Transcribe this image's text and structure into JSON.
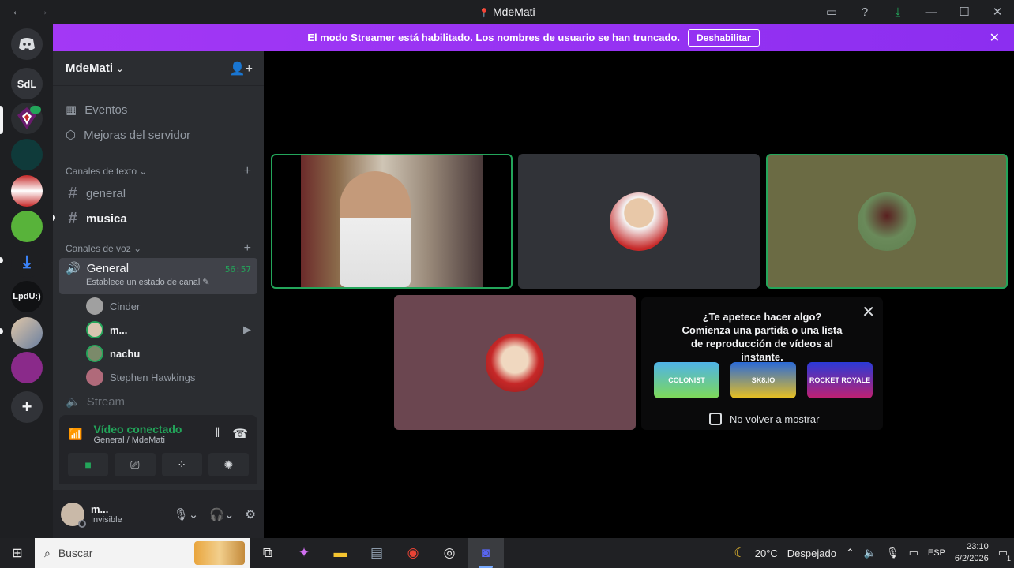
{
  "window": {
    "title": "MdeMati",
    "nav_back": "←",
    "nav_forward": "→"
  },
  "banner": {
    "message": "El modo Streamer está habilitado. Los nombres de usuario se han truncado.",
    "button": "Deshabilitar"
  },
  "guilds": [
    {
      "label": "SdL"
    },
    {
      "label": "LpdU:)"
    }
  ],
  "server": {
    "name": "MdeMati",
    "items": [
      {
        "label": "Eventos"
      },
      {
        "label": "Mejoras del servidor"
      }
    ],
    "text_category": "Canales de texto",
    "text_channels": [
      {
        "label": "general"
      },
      {
        "label": "musica"
      }
    ],
    "voice_category": "Canales de voz",
    "voice_channel": {
      "label": "General",
      "timer": "56:57",
      "status": "Establece un estado de canal"
    },
    "voice_users": [
      {
        "name": "Cinder"
      },
      {
        "name": "m..."
      },
      {
        "name": "nachu"
      },
      {
        "name": "Stephen Hawkings"
      }
    ],
    "next_channel": "Stream"
  },
  "rtc": {
    "status": "Vídeo conectado",
    "location": "General / MdeMati"
  },
  "user": {
    "name": "m...",
    "status": "Invisible"
  },
  "activity": {
    "title": "¿Te apetece hacer algo?",
    "body": "Comienza una partida o una lista de reproducción de vídeos al instante.",
    "games": [
      {
        "label": "COLONIST"
      },
      {
        "label": "SK8.IO"
      },
      {
        "label": "ROCKET ROYALE"
      }
    ],
    "dont_show": "No volver a mostrar"
  },
  "taskbar": {
    "search_placeholder": "Buscar",
    "weather": "20°C",
    "weather_desc": "Despejado",
    "lang": "ESP",
    "time": "23:10",
    "date": "6/2/2026",
    "notif_count": "1"
  },
  "colors": {
    "brand": "#5865f2",
    "banner": "#9b30ff",
    "connected": "#23a55a"
  }
}
